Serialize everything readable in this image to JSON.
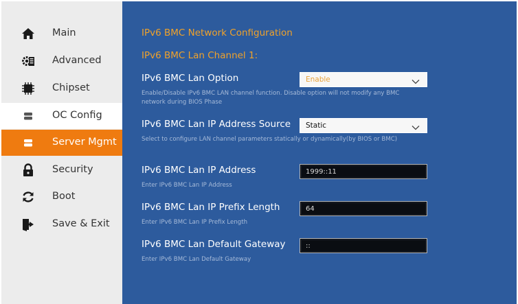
{
  "sidebar": {
    "items": [
      {
        "label": "Main",
        "icon": "home-icon"
      },
      {
        "label": "Advanced",
        "icon": "advanced-gear-icon"
      },
      {
        "label": "Chipset",
        "icon": "chip-icon"
      },
      {
        "label": "OC Config",
        "icon": "oc-config-icon"
      },
      {
        "label": "Server Mgmt",
        "icon": "server-icon"
      },
      {
        "label": "Security",
        "icon": "lock-icon"
      },
      {
        "label": "Boot",
        "icon": "refresh-icon"
      },
      {
        "label": "Save & Exit",
        "icon": "exit-door-icon"
      }
    ],
    "active_item": "Server Mgmt",
    "hovered_item": "OC Config"
  },
  "main": {
    "title": "IPv6 BMC Network Configuration",
    "channel_title": "IPv6 BMC Lan Channel 1:",
    "options": [
      {
        "label": "IPv6 BMC Lan Option",
        "type": "select",
        "value": "Enable",
        "help": "Enable/Disable IPv6 BMC LAN channel function. Disable option will not modify any BMC network during BIOS Phase"
      },
      {
        "label": "IPv6 BMC Lan IP Address Source",
        "type": "select",
        "value": "Static",
        "help": "Select to configure LAN channel parameters statically or dynamically(by BIOS or BMC)"
      },
      {
        "label": "IPv6 BMC Lan IP Address",
        "type": "text",
        "value": "1999::11",
        "help": "Enter IPv6 BMC Lan IP Address"
      },
      {
        "label": "IPv6 BMC Lan IP Prefix Length",
        "type": "text",
        "value": "64",
        "help": "Enter IPv6 BMC Lan IP Prefix  Length"
      },
      {
        "label": "IPv6 BMC Lan Default Gateway",
        "type": "text",
        "value": "::",
        "help": "Enter IPv6 BMC Lan Default Gateway"
      }
    ]
  },
  "colors": {
    "accent": "#ef7b10",
    "panel_bg": "#2d5b9d",
    "heading": "#f0a22a",
    "sidebar_bg": "#ececec"
  }
}
